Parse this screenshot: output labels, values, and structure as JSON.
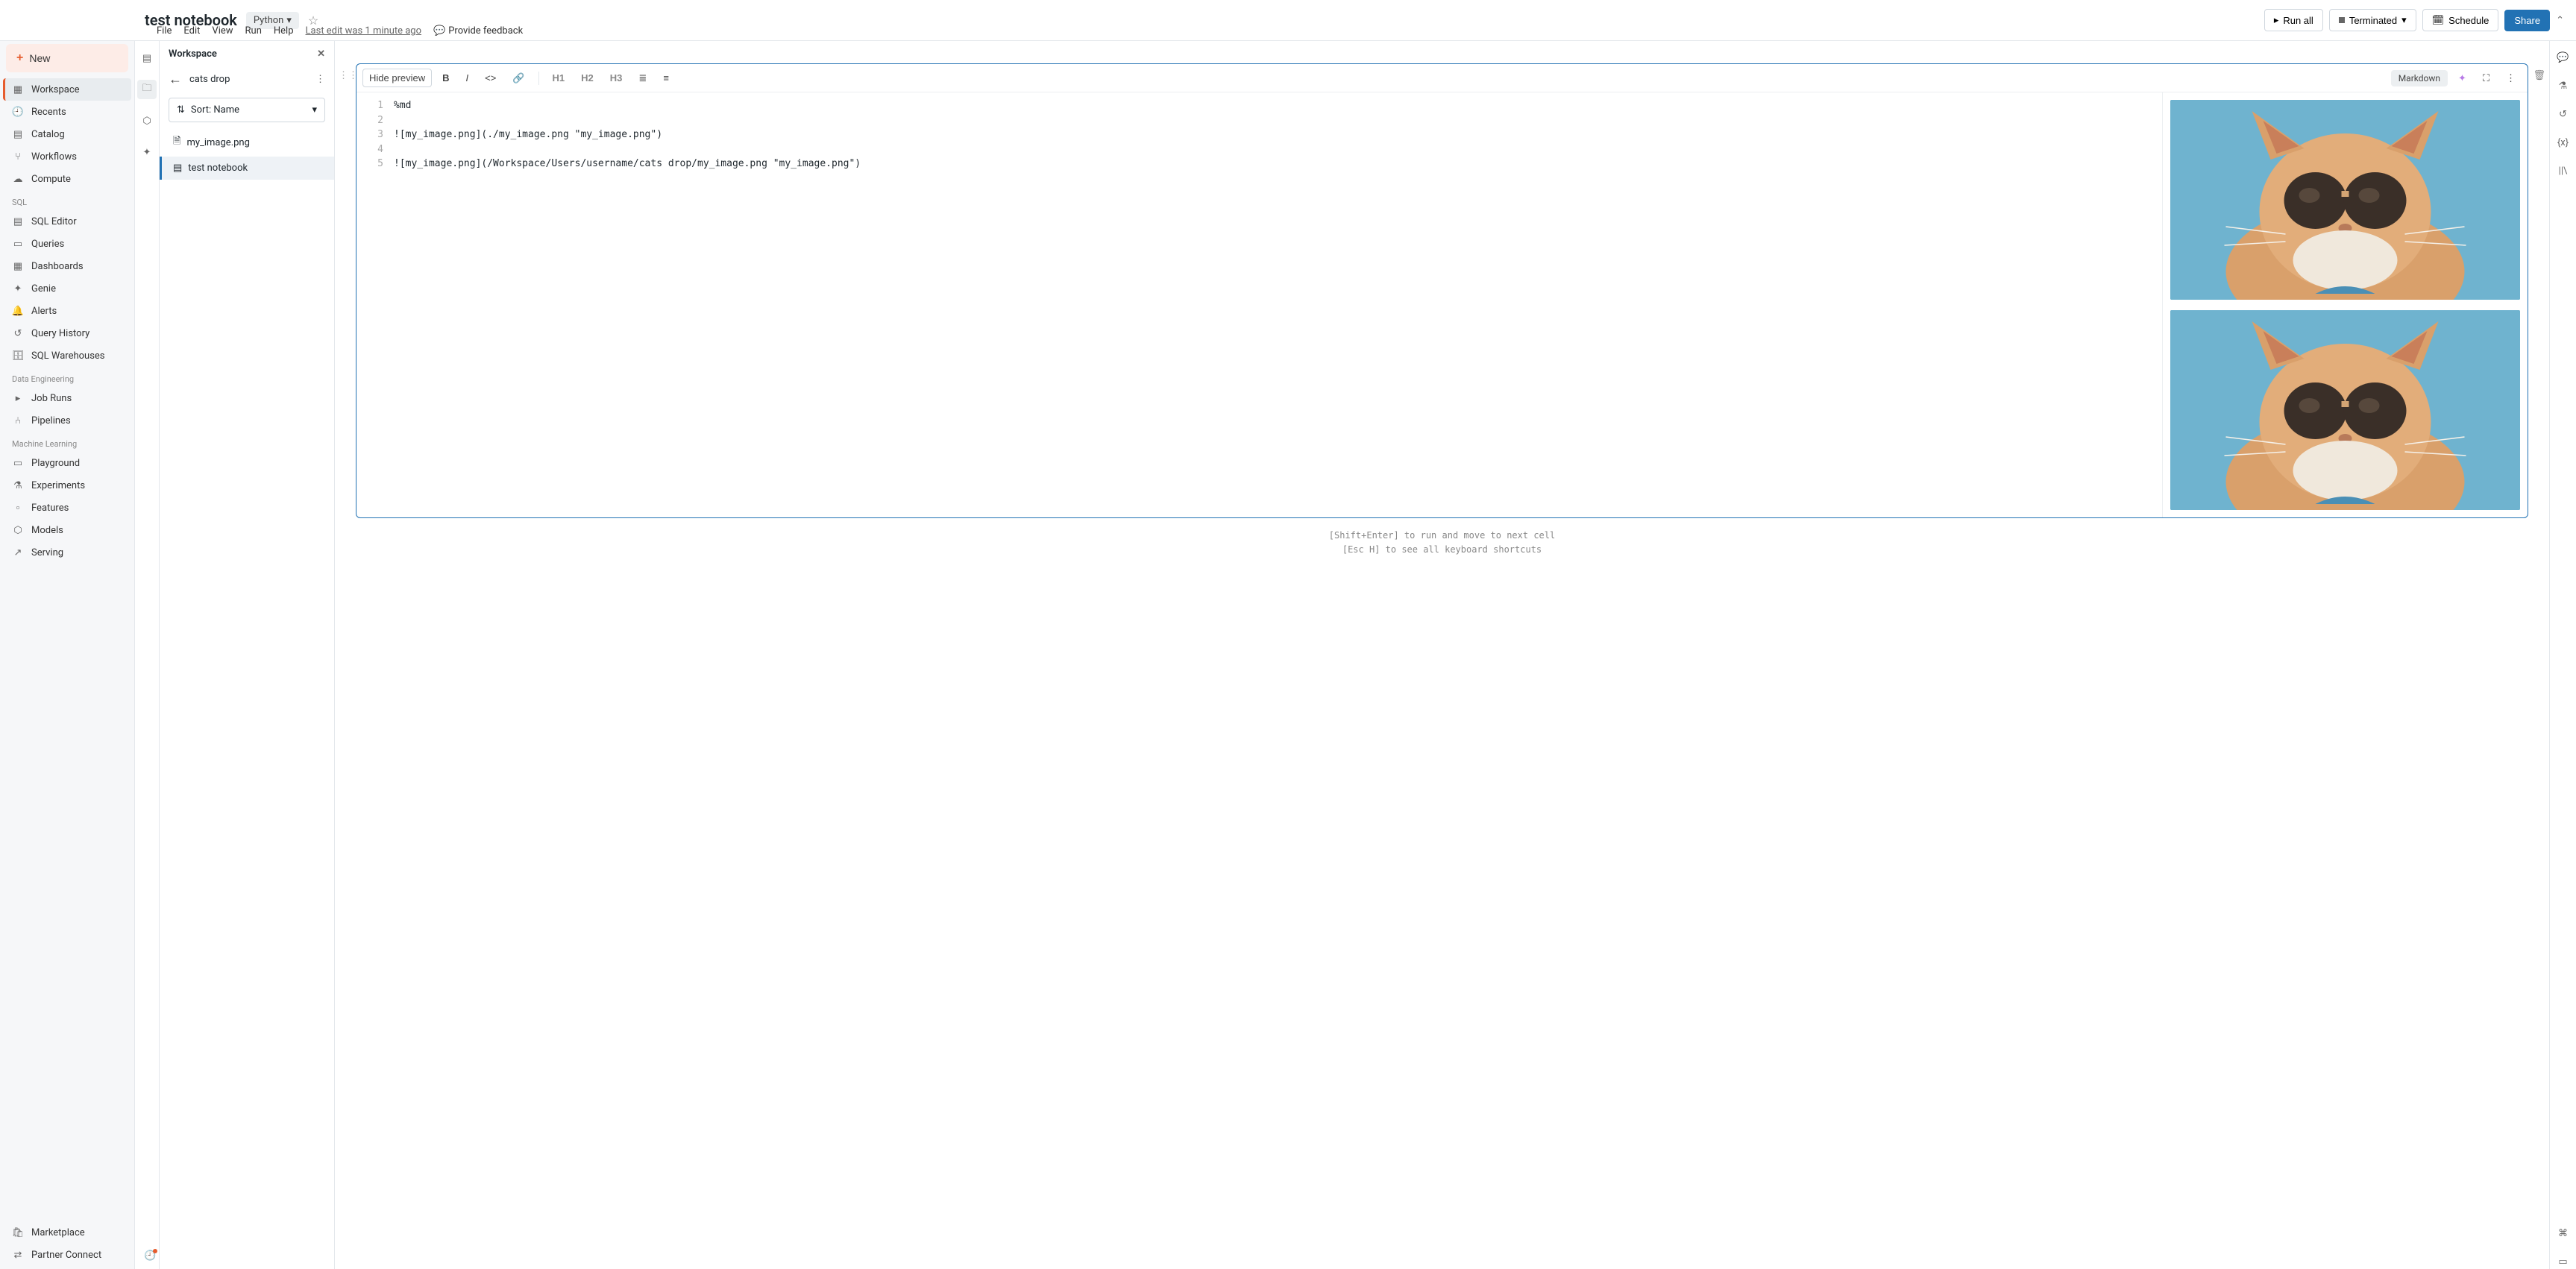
{
  "header": {
    "title": "test notebook",
    "language": "Python",
    "runAll": "Run all",
    "status": "Terminated",
    "schedule": "Schedule",
    "share": "Share"
  },
  "menu": {
    "items": [
      "File",
      "Edit",
      "View",
      "Run",
      "Help"
    ],
    "editInfo": "Last edit was 1 minute ago",
    "feedback": "Provide feedback"
  },
  "sidebar": {
    "newLabel": "New",
    "nav": [
      {
        "label": "Workspace",
        "active": true
      },
      {
        "label": "Recents"
      },
      {
        "label": "Catalog"
      },
      {
        "label": "Workflows"
      },
      {
        "label": "Compute"
      }
    ],
    "sections": [
      {
        "title": "SQL",
        "items": [
          "SQL Editor",
          "Queries",
          "Dashboards",
          "Genie",
          "Alerts",
          "Query History",
          "SQL Warehouses"
        ]
      },
      {
        "title": "Data Engineering",
        "items": [
          "Job Runs",
          "Pipelines"
        ]
      },
      {
        "title": "Machine Learning",
        "items": [
          "Playground",
          "Experiments",
          "Features",
          "Models",
          "Serving"
        ]
      }
    ],
    "footer": [
      "Marketplace",
      "Partner Connect"
    ]
  },
  "workspace": {
    "title": "Workspace",
    "breadcrumb": "cats drop",
    "sort": "Sort: Name",
    "files": [
      {
        "name": "my_image.png",
        "selected": false
      },
      {
        "name": "test notebook",
        "selected": true
      }
    ]
  },
  "cell": {
    "hidePreview": "Hide preview",
    "typeLabel": "Markdown",
    "toolbar": {
      "h1": "H1",
      "h2": "H2",
      "h3": "H3"
    },
    "lines": [
      {
        "n": "1",
        "t": "%md"
      },
      {
        "n": "2",
        "t": ""
      },
      {
        "n": "3",
        "t": "![my_image.png](./my_image.png \"my_image.png\")"
      },
      {
        "n": "4",
        "t": ""
      },
      {
        "n": "5",
        "t": "![my_image.png](/Workspace/Users/username/cats drop/my_image.png \"my_image.png\")"
      }
    ]
  },
  "hints": {
    "l1": "[Shift+Enter] to run and move to next cell",
    "l2": "[Esc H] to see all keyboard shortcuts"
  }
}
